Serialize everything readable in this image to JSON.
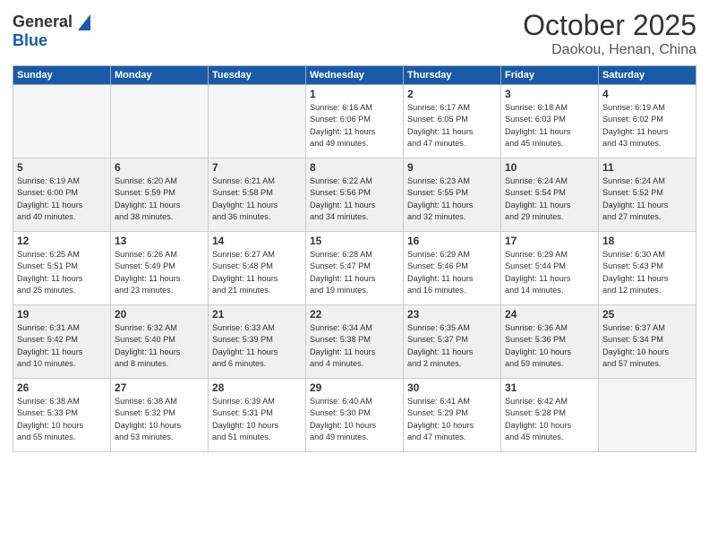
{
  "header": {
    "logo_line1": "General",
    "logo_line2": "Blue",
    "month": "October 2025",
    "location": "Daokou, Henan, China"
  },
  "weekdays": [
    "Sunday",
    "Monday",
    "Tuesday",
    "Wednesday",
    "Thursday",
    "Friday",
    "Saturday"
  ],
  "weeks": [
    [
      {
        "day": "",
        "detail": ""
      },
      {
        "day": "",
        "detail": ""
      },
      {
        "day": "",
        "detail": ""
      },
      {
        "day": "1",
        "detail": "Sunrise: 6:16 AM\nSunset: 6:06 PM\nDaylight: 11 hours\nand 49 minutes."
      },
      {
        "day": "2",
        "detail": "Sunrise: 6:17 AM\nSunset: 6:05 PM\nDaylight: 11 hours\nand 47 minutes."
      },
      {
        "day": "3",
        "detail": "Sunrise: 6:18 AM\nSunset: 6:03 PM\nDaylight: 11 hours\nand 45 minutes."
      },
      {
        "day": "4",
        "detail": "Sunrise: 6:19 AM\nSunset: 6:02 PM\nDaylight: 11 hours\nand 43 minutes."
      }
    ],
    [
      {
        "day": "5",
        "detail": "Sunrise: 6:19 AM\nSunset: 6:00 PM\nDaylight: 11 hours\nand 40 minutes."
      },
      {
        "day": "6",
        "detail": "Sunrise: 6:20 AM\nSunset: 5:59 PM\nDaylight: 11 hours\nand 38 minutes."
      },
      {
        "day": "7",
        "detail": "Sunrise: 6:21 AM\nSunset: 5:58 PM\nDaylight: 11 hours\nand 36 minutes."
      },
      {
        "day": "8",
        "detail": "Sunrise: 6:22 AM\nSunset: 5:56 PM\nDaylight: 11 hours\nand 34 minutes."
      },
      {
        "day": "9",
        "detail": "Sunrise: 6:23 AM\nSunset: 5:55 PM\nDaylight: 11 hours\nand 32 minutes."
      },
      {
        "day": "10",
        "detail": "Sunrise: 6:24 AM\nSunset: 5:54 PM\nDaylight: 11 hours\nand 29 minutes."
      },
      {
        "day": "11",
        "detail": "Sunrise: 6:24 AM\nSunset: 5:52 PM\nDaylight: 11 hours\nand 27 minutes."
      }
    ],
    [
      {
        "day": "12",
        "detail": "Sunrise: 6:25 AM\nSunset: 5:51 PM\nDaylight: 11 hours\nand 25 minutes."
      },
      {
        "day": "13",
        "detail": "Sunrise: 6:26 AM\nSunset: 5:49 PM\nDaylight: 11 hours\nand 23 minutes."
      },
      {
        "day": "14",
        "detail": "Sunrise: 6:27 AM\nSunset: 5:48 PM\nDaylight: 11 hours\nand 21 minutes."
      },
      {
        "day": "15",
        "detail": "Sunrise: 6:28 AM\nSunset: 5:47 PM\nDaylight: 11 hours\nand 19 minutes."
      },
      {
        "day": "16",
        "detail": "Sunrise: 6:29 AM\nSunset: 5:46 PM\nDaylight: 11 hours\nand 16 minutes."
      },
      {
        "day": "17",
        "detail": "Sunrise: 6:29 AM\nSunset: 5:44 PM\nDaylight: 11 hours\nand 14 minutes."
      },
      {
        "day": "18",
        "detail": "Sunrise: 6:30 AM\nSunset: 5:43 PM\nDaylight: 11 hours\nand 12 minutes."
      }
    ],
    [
      {
        "day": "19",
        "detail": "Sunrise: 6:31 AM\nSunset: 5:42 PM\nDaylight: 11 hours\nand 10 minutes."
      },
      {
        "day": "20",
        "detail": "Sunrise: 6:32 AM\nSunset: 5:40 PM\nDaylight: 11 hours\nand 8 minutes."
      },
      {
        "day": "21",
        "detail": "Sunrise: 6:33 AM\nSunset: 5:39 PM\nDaylight: 11 hours\nand 6 minutes."
      },
      {
        "day": "22",
        "detail": "Sunrise: 6:34 AM\nSunset: 5:38 PM\nDaylight: 11 hours\nand 4 minutes."
      },
      {
        "day": "23",
        "detail": "Sunrise: 6:35 AM\nSunset: 5:37 PM\nDaylight: 11 hours\nand 2 minutes."
      },
      {
        "day": "24",
        "detail": "Sunrise: 6:36 AM\nSunset: 5:36 PM\nDaylight: 10 hours\nand 59 minutes."
      },
      {
        "day": "25",
        "detail": "Sunrise: 6:37 AM\nSunset: 5:34 PM\nDaylight: 10 hours\nand 57 minutes."
      }
    ],
    [
      {
        "day": "26",
        "detail": "Sunrise: 6:38 AM\nSunset: 5:33 PM\nDaylight: 10 hours\nand 55 minutes."
      },
      {
        "day": "27",
        "detail": "Sunrise: 6:38 AM\nSunset: 5:32 PM\nDaylight: 10 hours\nand 53 minutes."
      },
      {
        "day": "28",
        "detail": "Sunrise: 6:39 AM\nSunset: 5:31 PM\nDaylight: 10 hours\nand 51 minutes."
      },
      {
        "day": "29",
        "detail": "Sunrise: 6:40 AM\nSunset: 5:30 PM\nDaylight: 10 hours\nand 49 minutes."
      },
      {
        "day": "30",
        "detail": "Sunrise: 6:41 AM\nSunset: 5:29 PM\nDaylight: 10 hours\nand 47 minutes."
      },
      {
        "day": "31",
        "detail": "Sunrise: 6:42 AM\nSunset: 5:28 PM\nDaylight: 10 hours\nand 45 minutes."
      },
      {
        "day": "",
        "detail": ""
      }
    ]
  ]
}
